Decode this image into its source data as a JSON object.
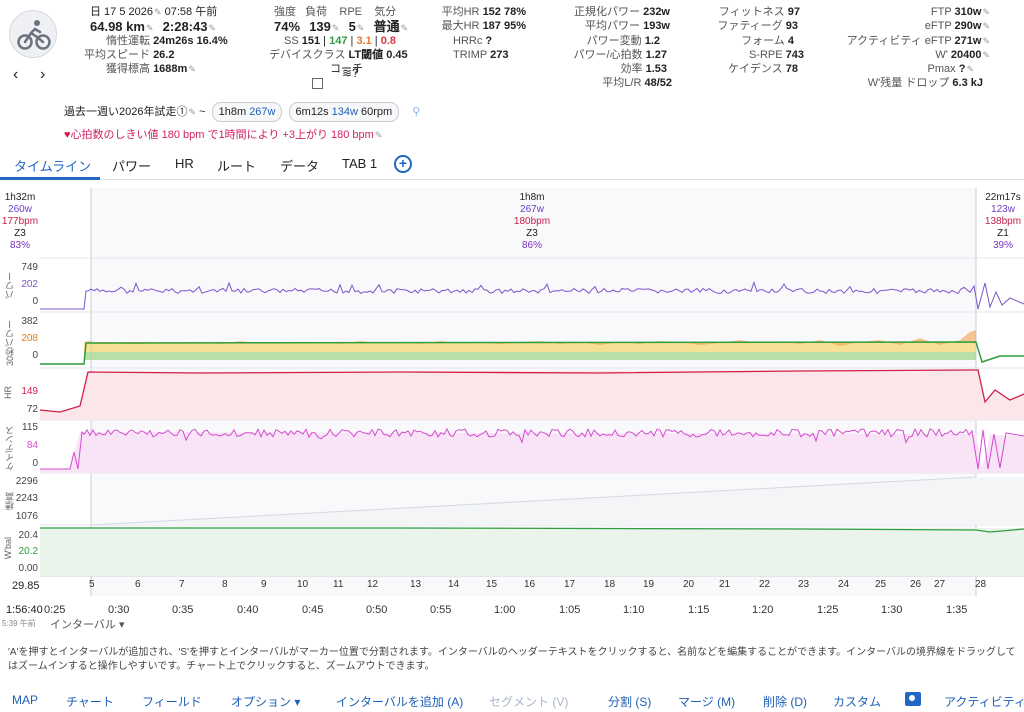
{
  "header": {
    "date": "日 17 5 2026",
    "time": "07:58 午前",
    "distance": "64.98 km",
    "duration": "2:28:43",
    "coasting_label": "惰性運転",
    "coasting_value": "24m26s 16.4%",
    "avg_speed_label": "平均スピード",
    "avg_speed_value": "26.2",
    "elevation_label": "獲得標高",
    "elevation_value": "1688m",
    "intensity_label": "強度",
    "intensity_value": "74%",
    "load_label": "負荷",
    "load_value": "139",
    "rpe_label": "RPE",
    "rpe_value": "5",
    "feel_label": "気分",
    "feel_value": "普通",
    "ss_label": "SS",
    "ss_value": "151",
    "ss_green": "147",
    "ss_orange": "3.1",
    "ss_red": "0.8",
    "device_class_label": "デバイスクラス",
    "device_class_value": "LT閾値",
    "device_class_num": "0.45",
    "coach_label": "コーチ",
    "avg_hr_label": "平均HR",
    "avg_hr_value": "152 78%",
    "max_hr_label": "最大HR",
    "max_hr_value": "187 95%",
    "hrrc_label": "HRRc",
    "hrrc_value": "?",
    "trimp_label": "TRIMP",
    "trimp_value": "273",
    "np_label": "正規化パワー",
    "np_value": "232w",
    "avg_power_label": "平均パワー",
    "avg_power_value": "193w",
    "variability_label": "パワー変動",
    "variability_value": "1.2",
    "power_hr_label": "パワー/心拍数",
    "power_hr_value": "1.27",
    "efficiency_label": "効率",
    "efficiency_value": "1.53",
    "lr_label": "平均L/R",
    "lr_value": "48/52",
    "fitness_label": "フィットネス",
    "fitness_value": "97",
    "fatigue_label": "ファティーグ",
    "fatigue_value": "93",
    "form_label": "フォーム",
    "form_value": "4",
    "srpe_label": "S-RPE",
    "srpe_value": "743",
    "cadence_label": "ケイデンス",
    "cadence_value": "78",
    "ftp_label": "FTP",
    "ftp_value": "310w",
    "eftp_label": "eFTP",
    "eftp_value": "290w",
    "active_eftp_label": "アクティビティ eFTP",
    "active_eftp_value": "271w",
    "w_label": "W'",
    "w_value": "20400",
    "pmax_label": "Pmax",
    "pmax_value": "?",
    "wbal_drop_label": "W'残量 ドロップ",
    "wbal_drop_value": "6.3 kJ"
  },
  "range_line": {
    "prefix": "過去一週い2026年試走①",
    "tilde": "~",
    "pill1_time": "1h8m",
    "pill1_power": "267w",
    "pill2_time": "6m12s",
    "pill2_power": "134w",
    "pill2_cad": "60rpm"
  },
  "hr_threshold_note": "心拍数のしきい値 180 bpm で1時間により +3上がり 180 bpm",
  "tabs": [
    "タイムライン",
    "パワー",
    "HR",
    "ルート",
    "データ",
    "TAB 1"
  ],
  "intervals": [
    {
      "time": "1h32m",
      "power": "260w",
      "hr": "177bpm",
      "zone": "Z3",
      "pct": "83%"
    },
    {
      "time": "1h8m",
      "power": "267w",
      "hr": "180bpm",
      "zone": "Z3",
      "pct": "86%"
    },
    {
      "time": "22m17s",
      "power": "123w",
      "hr": "138bpm",
      "zone": "Z1",
      "pct": "39%"
    }
  ],
  "panels": {
    "power": {
      "label": "パワー",
      "ticks": [
        "749",
        "202",
        "0"
      ]
    },
    "w30": {
      "label": "30秒パワー",
      "ticks": [
        "382",
        "208",
        "0"
      ]
    },
    "hr": {
      "label": "HR",
      "ticks": [
        "149",
        "72"
      ]
    },
    "cadence": {
      "label": "ケイデンス",
      "ticks": [
        "115",
        "84",
        "0"
      ]
    },
    "altitude": {
      "label": "標高",
      "ticks": [
        "2296",
        "2243",
        "1076"
      ]
    },
    "wbal": {
      "label": "W'bal",
      "ticks": [
        "20.4",
        "20.2",
        "0.00"
      ]
    }
  },
  "interval_markers": [
    "5",
    "6",
    "7",
    "8",
    "9",
    "10",
    "11",
    "12",
    "13",
    "14",
    "15",
    "16",
    "17",
    "18",
    "19",
    "20",
    "21",
    "22",
    "23",
    "24",
    "25",
    "26",
    "27",
    "28"
  ],
  "x_labels": {
    "left_value": "29.85",
    "start_time": "1:56:40",
    "start_clock": "5:39 午前",
    "ticks": [
      "0:25",
      "0:30",
      "0:35",
      "0:40",
      "0:45",
      "0:50",
      "0:55",
      "1:00",
      "1:05",
      "1:10",
      "1:15",
      "1:20",
      "1:25",
      "1:30",
      "1:35"
    ]
  },
  "interval_dropdown": "インターバル",
  "footnote": "'A'を押すとインターバルが追加され、'S'を押すとインターバルがマーカー位置で分割されます。インターバルのヘッダーテキストをクリックすると、名前などを編集することができます。インターバルの境界線をドラッグして はズームインすると操作しやすいです。チャート上でクリックすると、ズームアウトできます。",
  "toolbar": [
    "MAP",
    "チャート",
    "フィールド",
    "オプション ▾",
    "インターバルを追加 (A)",
    "セグメント (V)",
    "分割 (S)",
    "マージ (M)",
    "削除 (D)",
    "カスタム",
    "アクティビティ"
  ],
  "colors": {
    "accent": "#1f68c4",
    "power": "#7b55c9",
    "hr": "#d11f4a",
    "cadence": "#d44bd0",
    "wbal": "#2e9e3f"
  }
}
